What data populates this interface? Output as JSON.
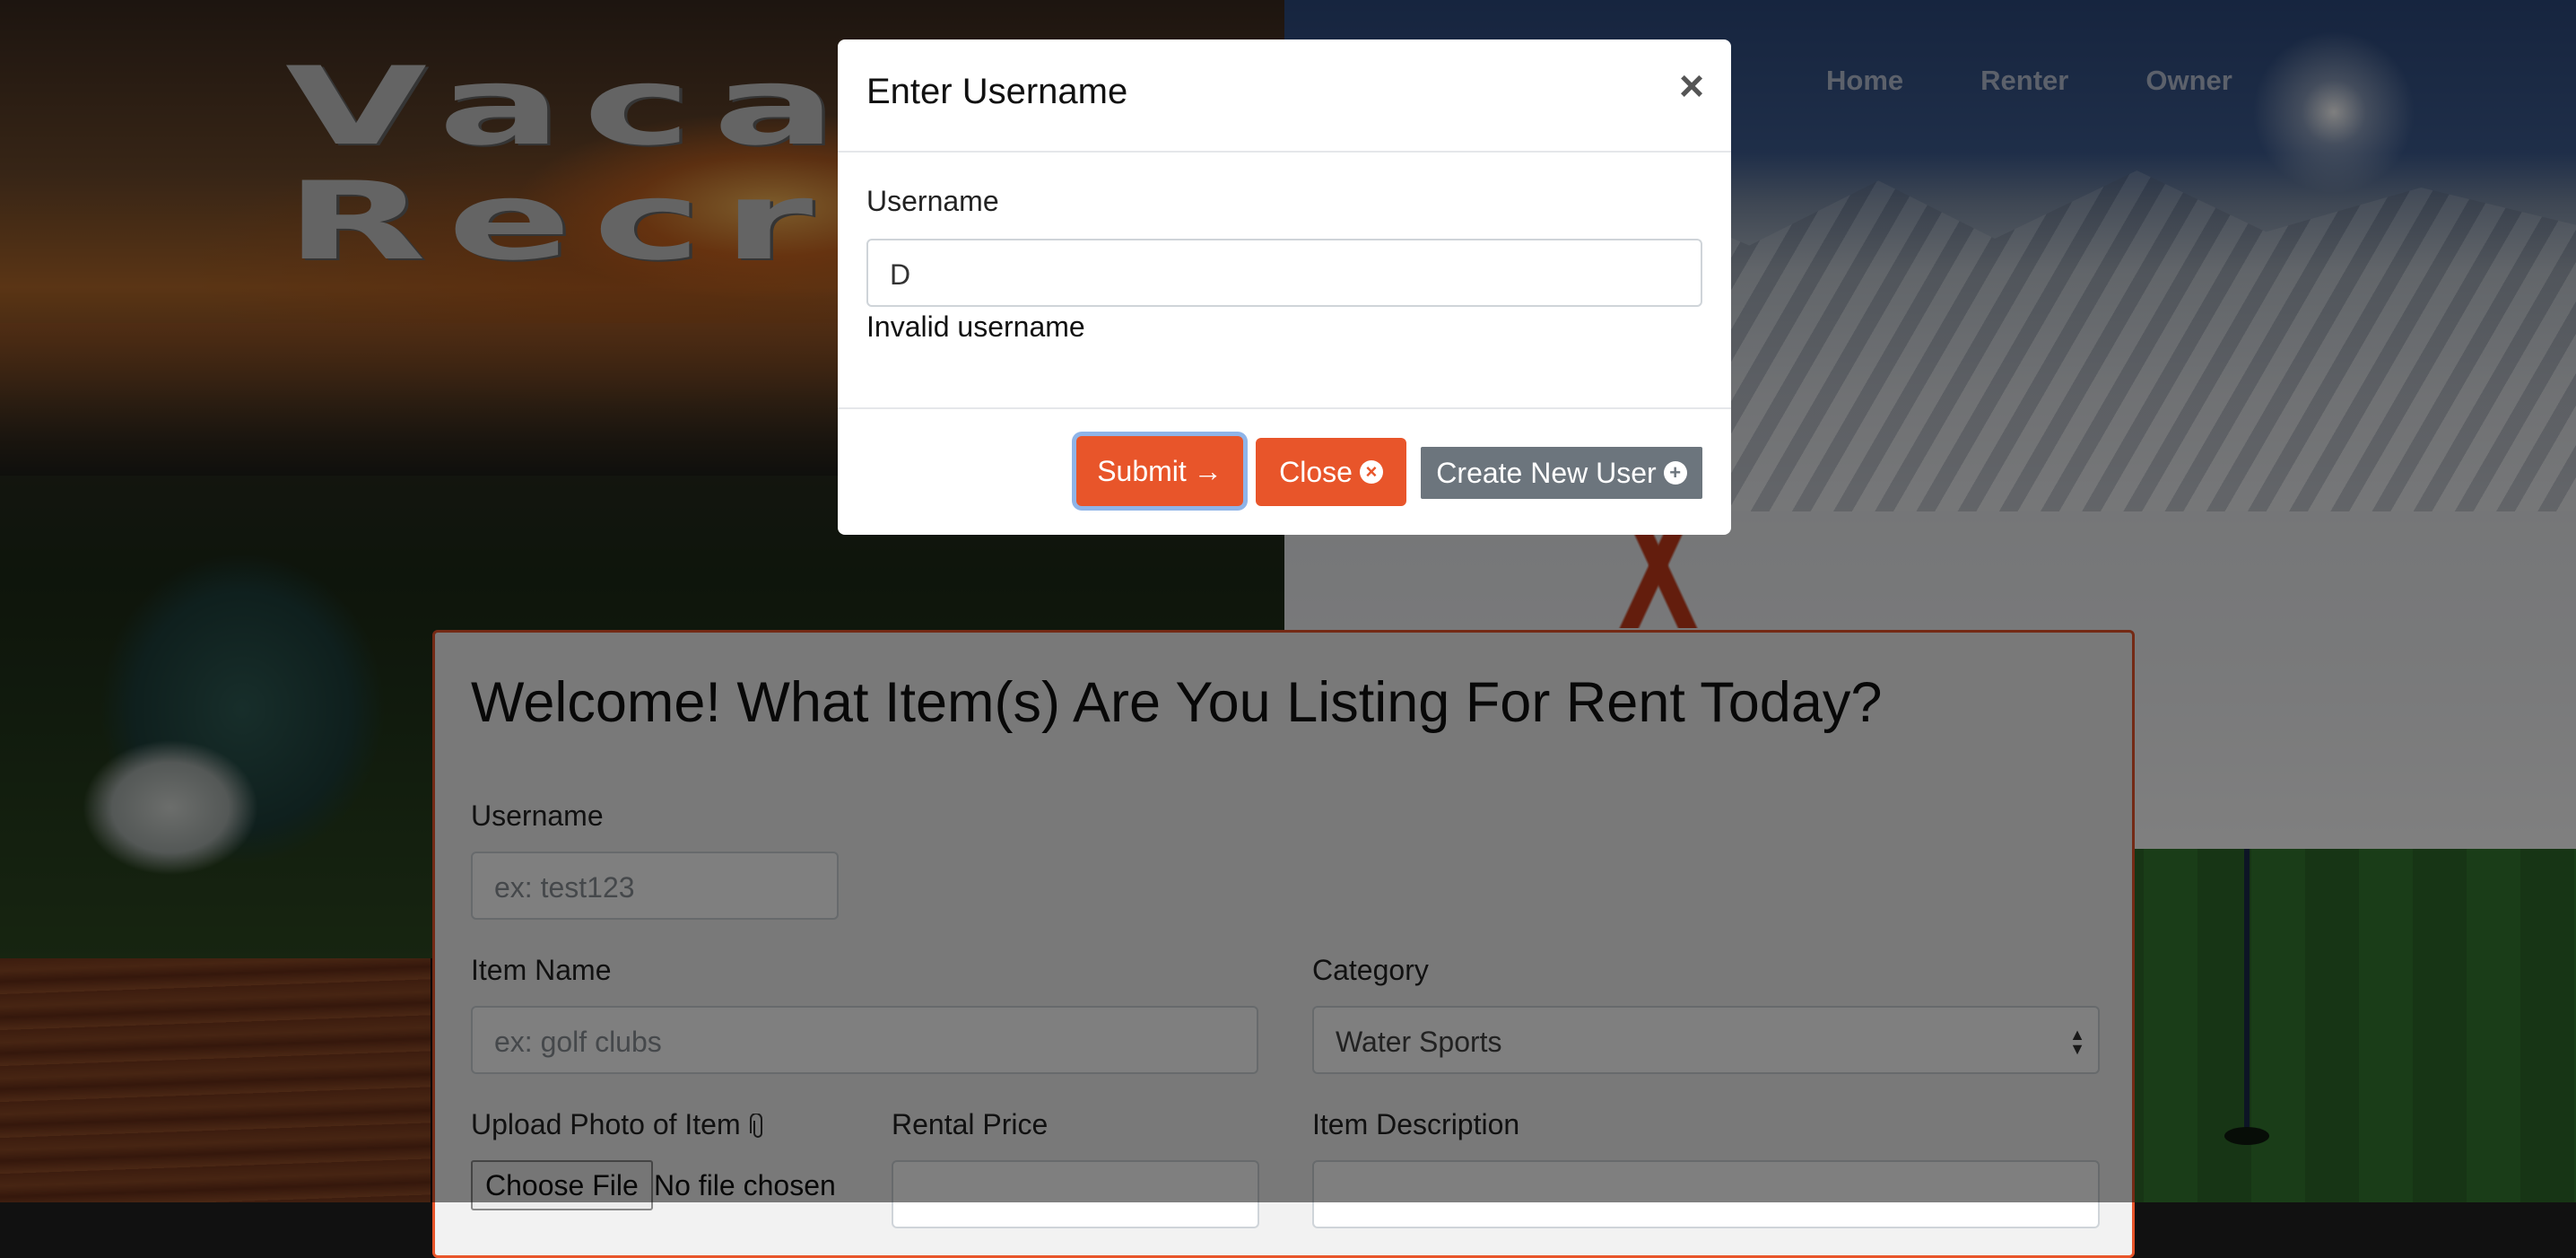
{
  "header": {
    "logo_line1": "Vacati",
    "logo_line2": "Recre",
    "nav": [
      "Home",
      "Renter",
      "Owner"
    ]
  },
  "form": {
    "heading": "Welcome! What Item(s) Are You Listing For Rent Today?",
    "username_label": "Username",
    "username_placeholder": "ex: test123",
    "item_name_label": "Item Name",
    "item_name_placeholder": "ex: golf clubs",
    "category_label": "Category",
    "category_selected": "Water Sports",
    "upload_label": "Upload Photo of Item",
    "choose_file_label": "Choose File",
    "no_file_text": "No file chosen",
    "rental_price_label": "Rental Price",
    "item_description_label": "Item Description"
  },
  "modal": {
    "title": "Enter Username",
    "close_symbol": "×",
    "field_label": "Username",
    "field_value": "D",
    "error_text": "Invalid username",
    "submit_label": "Submit",
    "close_label": "Close",
    "create_label": "Create New User"
  },
  "colors": {
    "accent": "#e8552a",
    "secondary": "#6c757d",
    "focus_ring": "#8fb4e8"
  },
  "icons": {
    "submit": "arrow-right-icon",
    "close": "x-circle-icon",
    "create": "plus-circle-icon",
    "upload": "paperclip-icon"
  }
}
